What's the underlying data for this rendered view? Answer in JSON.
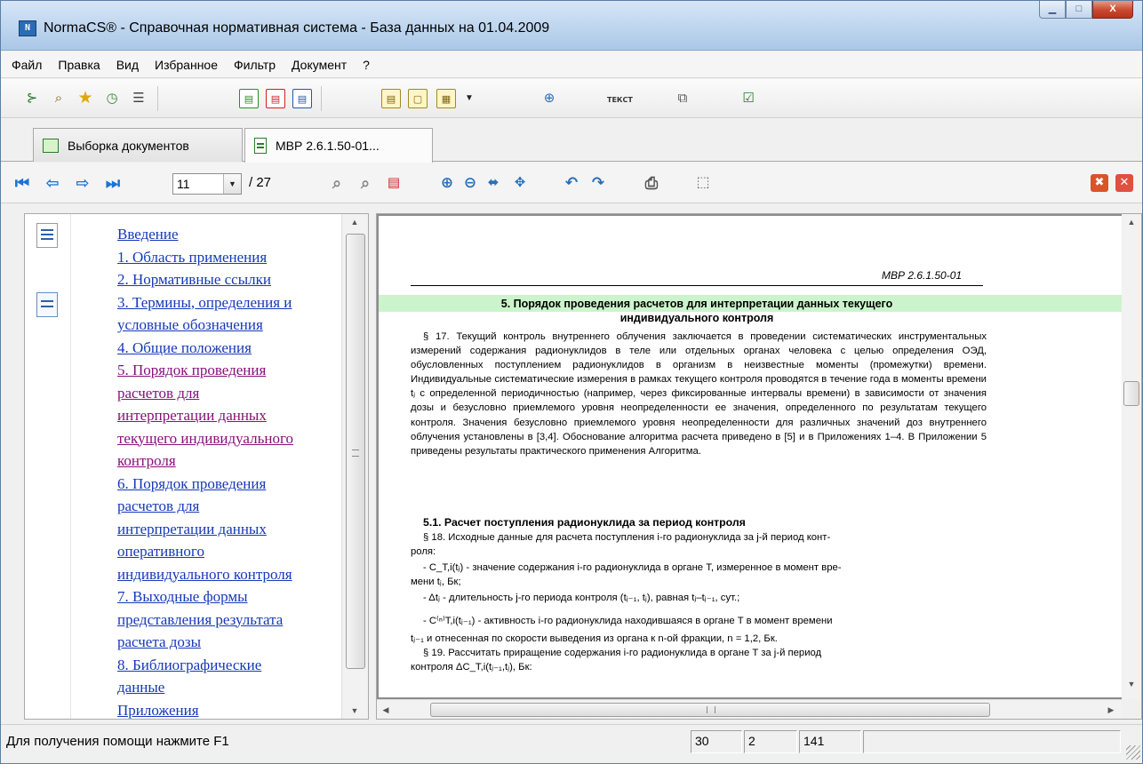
{
  "window": {
    "title": "NormaCS® - Справочная нормативная система - База данных на 01.04.2009",
    "app_icon_text": "N",
    "controls": {
      "minimize": "▁",
      "maximize": "□",
      "close": "X"
    }
  },
  "menu": {
    "items": [
      "Файл",
      "Правка",
      "Вид",
      "Избранное",
      "Фильтр",
      "Документ",
      "?"
    ]
  },
  "toolbar": {
    "text_button_label": "ТЕКСТ"
  },
  "tabs": [
    {
      "label": "Выборка документов",
      "icon": "document-list-icon"
    },
    {
      "label": "МВР 2.6.1.50-01...",
      "icon": "document-icon",
      "active": true
    }
  ],
  "navigation": {
    "current_page": "11",
    "total_pages": "/ 27"
  },
  "toc": {
    "items": [
      {
        "text": "Введение",
        "visited": false
      },
      {
        "text": "1. Область применения",
        "visited": false
      },
      {
        "text": "2. Нормативные ссылки",
        "visited": false
      },
      {
        "text": "3. Термины, определения и",
        "visited": false
      },
      {
        "text": "условные обозначения",
        "visited": false
      },
      {
        "text": "4. Общие положения",
        "visited": false
      },
      {
        "text": "5. Порядок проведения",
        "visited": true
      },
      {
        "text": "расчетов для",
        "visited": true
      },
      {
        "text": "интерпретации данных",
        "visited": true
      },
      {
        "text": "текущего индивидуального",
        "visited": true
      },
      {
        "text": "контроля",
        "visited": true
      },
      {
        "text": "6. Порядок проведения",
        "visited": false
      },
      {
        "text": "расчетов для",
        "visited": false
      },
      {
        "text": "интерпретации данных",
        "visited": false
      },
      {
        "text": "оперативного",
        "visited": false
      },
      {
        "text": "индивидуального контроля",
        "visited": false
      },
      {
        "text": "7. Выходные формы",
        "visited": false
      },
      {
        "text": "представления результата",
        "visited": false
      },
      {
        "text": "расчета дозы",
        "visited": false
      },
      {
        "text": "8. Библиографические",
        "visited": false
      },
      {
        "text": "данные",
        "visited": false
      },
      {
        "text": "Приложения",
        "visited": false
      }
    ]
  },
  "document": {
    "header": "МВР 2.6.1.50-01",
    "section_title_1": "5. Порядок проведения расчетов для интерпретации данных текущего",
    "section_title_2": "индивидуального контроля",
    "para_17": "§ 17. Текущий контроль внутреннего облучения заключается в проведении систематических инструментальных измерений содержания радионуклидов в теле или отдельных органах человека с целью определения ОЭД, обусловленных поступлением радионуклидов в организм в неизвестные моменты (промежутки) времени. Индивидуальные систематические измерения в рамках текущего контроля проводятся в течение года в моменты времени tⱼ с определенной периодичностью (например, через фиксированные интервалы времени) в зависимости от значения дозы и безусловно приемлемого уровня неопределенности ее значения, определенного по результатам текущего контроля. Значения безусловно приемлемого уровня неопределенности для различных значений доз внутреннего облучения установлены в [3,4]. Обоснование алгоритма расчета приведено в [5] и в Приложениях 1–4. В Приложении 5 приведены результаты практического применения Алгоритма.",
    "subhead_51": "5.1. Расчет поступления радионуклида за период контроля",
    "para_18_1": "§ 18. Исходные данные для расчета поступления i-го радионуклида за j-й период конт-",
    "para_18_2": "роля:",
    "item_1a": "- C_T,i(tⱼ) - значение содержания i-го радионуклида в органе T, измеренное в момент вре-",
    "item_1b": "мени tⱼ, Бк;",
    "item_2": "- Δtⱼ - длительность j-го периода контроля (tⱼ₋₁, tⱼ), равная tⱼ–tⱼ₋₁, сут.;",
    "item_3a": "- C⁽ⁿ⁾T,i(tⱼ₋₁)  - активность i-го радионуклида находившаяся в органе T в момент времени",
    "item_3b": "tⱼ₋₁ и отнесенная по скорости выведения из органа к n-ой фракции, n = 1,2, Бк.",
    "para_19_1": "§ 19. Рассчитать приращение содержания i-го радионуклида в органе T за j-й период",
    "para_19_2": "контроля ΔC_T,i(tⱼ₋₁,tⱼ), Бк:"
  },
  "status": {
    "help_text": "Для получения помощи нажмите F1",
    "cell_1": "30",
    "cell_2": "2",
    "cell_3": "141",
    "cell_4": ""
  },
  "colors": {
    "link": "#1638b8",
    "visited_link": "#88107a",
    "section_highlight": "#ccf4cc",
    "nav_arrow": "#1a73d6"
  }
}
